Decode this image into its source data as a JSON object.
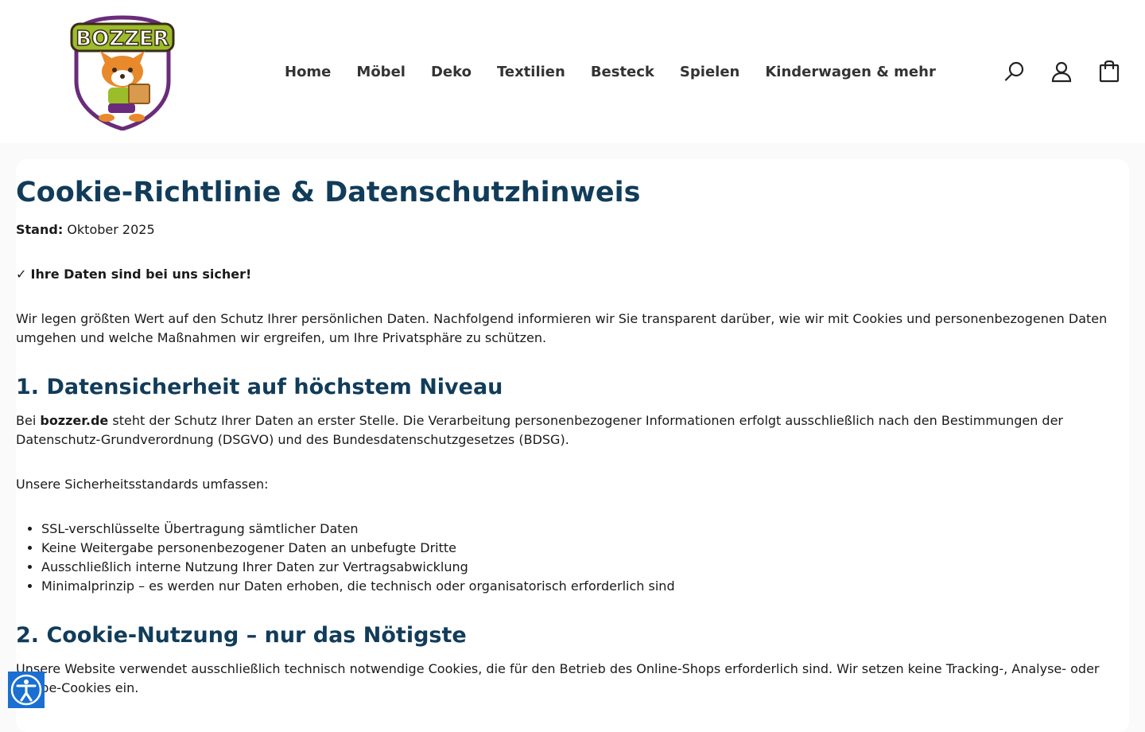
{
  "logo": {
    "text": "BOZZER"
  },
  "nav": {
    "items": [
      {
        "label": "Home"
      },
      {
        "label": "Möbel"
      },
      {
        "label": "Deko"
      },
      {
        "label": "Textilien"
      },
      {
        "label": "Besteck"
      },
      {
        "label": "Spielen"
      },
      {
        "label": "Kinderwagen & mehr"
      }
    ]
  },
  "header_icons": [
    "search-icon",
    "account-icon",
    "cart-icon"
  ],
  "colors": {
    "heading": "#113c5a",
    "accessibility_button": "#1a6fd1",
    "logo_accent": "#6a2c7a",
    "logo_text": "#9bbd2a"
  },
  "page": {
    "title": "Cookie-Richtlinie & Datenschutzhinweis",
    "stand_label": "Stand:",
    "stand_value": "Oktober 2025",
    "secure_check": "✓",
    "secure_text": "Ihre Daten sind bei uns sicher!",
    "intro": "Wir legen größten Wert auf den Schutz Ihrer persönlichen Daten. Nachfolgend informieren wir Sie transparent darüber, wie wir mit Cookies und personenbezogenen Daten umgehen und welche Maßnahmen wir ergreifen, um Ihre Privatsphäre zu schützen.",
    "section1": {
      "heading": "1. Datensicherheit auf höchstem Niveau",
      "p1_prefix": "Bei",
      "p1_brand": "bozzer.de",
      "p1_rest": "steht der Schutz Ihrer Daten an erster Stelle. Die Verarbeitung personenbezogener Informationen erfolgt ausschließlich nach den Bestimmungen der Datenschutz-Grundverordnung (DSGVO) und des Bundesdatenschutzgesetzes (BDSG).",
      "p2": "Unsere Sicherheitsstandards umfassen:",
      "list_glyph": "",
      "list": [
        "SSL-verschlüsselte Übertragung sämtlicher Daten",
        "Keine Weitergabe personenbezogener Daten an unbefugte Dritte",
        "Ausschließlich interne Nutzung Ihrer Daten zur Vertragsabwicklung",
        "Minimalprinzip – es werden nur Daten erhoben, die technisch oder organisatorisch erforderlich sind"
      ]
    },
    "section2": {
      "heading": "2. Cookie-Nutzung – nur das Nötigste",
      "p1": "Unsere Website verwendet ausschließlich technisch notwendige Cookies, die für den Betrieb des Online-Shops erforderlich sind. Wir setzen keine Tracking-, Analyse- oder Werbe-Cookies ein."
    }
  },
  "accessibility": {
    "icon": "accessibility-icon"
  }
}
